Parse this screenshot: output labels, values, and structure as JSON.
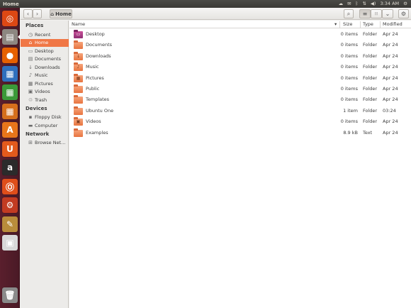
{
  "window": {
    "title": "Home"
  },
  "tray": {
    "indicators": [
      "cloud-icon",
      "mail-icon",
      "bluetooth-icon",
      "network-icon",
      "volume-icon",
      "gear-icon"
    ],
    "clock": "3:34 AM"
  },
  "launcher": {
    "items": [
      {
        "name": "ubuntu-dash-icon",
        "glyph": "◎",
        "color": "#dd4814"
      },
      {
        "name": "files-icon",
        "glyph": "▤",
        "color": "#8d8781"
      },
      {
        "name": "firefox-icon",
        "glyph": "●",
        "color": "#e66000"
      },
      {
        "name": "writer-icon",
        "glyph": "▦",
        "color": "#2f6fbd"
      },
      {
        "name": "calc-icon",
        "glyph": "▦",
        "color": "#3b9a38"
      },
      {
        "name": "impress-icon",
        "glyph": "▦",
        "color": "#d56f1c"
      },
      {
        "name": "software-center-icon",
        "glyph": "A",
        "color": "#e8751a"
      },
      {
        "name": "ubuntu-one-icon",
        "glyph": "U",
        "color": "#e35a1c"
      },
      {
        "name": "amazon-icon",
        "glyph": "a",
        "color": "#2b2b2b"
      },
      {
        "name": "ubuntu-one-music-icon",
        "glyph": "Ⓞ",
        "color": "#df4e1a"
      },
      {
        "name": "system-settings-icon",
        "glyph": "⚙",
        "color": "#c23b22"
      },
      {
        "name": "workspace-switcher-icon",
        "glyph": "✎",
        "color": "#b98c3b"
      },
      {
        "name": "floppy-icon",
        "glyph": "▣",
        "color": "#d8d8d8"
      },
      {
        "name": "trash-icon",
        "glyph": "🗑",
        "color": "#8a8a8a"
      }
    ]
  },
  "toolbar": {
    "back": "‹",
    "forward": "›",
    "breadcrumb_icon": "⌂",
    "breadcrumb": "Home",
    "search": "⌕",
    "list_view": "≡",
    "grid_view": "⦙⦙⦙",
    "dropdown": "⌄",
    "settings": "⚙"
  },
  "sidebar": {
    "sections": [
      {
        "heading": "Places",
        "items": [
          {
            "label": "Recent",
            "icon": "◷",
            "selected": false
          },
          {
            "label": "Home",
            "icon": "⌂",
            "selected": true
          },
          {
            "label": "Desktop",
            "icon": "▭",
            "selected": false
          },
          {
            "label": "Documents",
            "icon": "▤",
            "selected": false
          },
          {
            "label": "Downloads",
            "icon": "↓",
            "selected": false
          },
          {
            "label": "Music",
            "icon": "♪",
            "selected": false
          },
          {
            "label": "Pictures",
            "icon": "▦",
            "selected": false
          },
          {
            "label": "Videos",
            "icon": "▣",
            "selected": false
          },
          {
            "label": "Trash",
            "icon": "♲",
            "selected": false
          }
        ]
      },
      {
        "heading": "Devices",
        "items": [
          {
            "label": "Floppy Disk",
            "icon": "▪",
            "selected": false
          },
          {
            "label": "Computer",
            "icon": "▬",
            "selected": false
          }
        ]
      },
      {
        "heading": "Network",
        "items": [
          {
            "label": "Browse Net...",
            "icon": "⊞",
            "selected": false
          }
        ]
      }
    ]
  },
  "columns": {
    "name": "Name",
    "sort": "▾",
    "size": "Size",
    "type": "Type",
    "modified": "Modified"
  },
  "files": [
    {
      "name": "Desktop",
      "size": "0 items",
      "type": "Folder",
      "modified": "Apr 24",
      "icon": "desktop",
      "glyph": "▭"
    },
    {
      "name": "Documents",
      "size": "0 items",
      "type": "Folder",
      "modified": "Apr 24",
      "icon": "folder",
      "glyph": ""
    },
    {
      "name": "Downloads",
      "size": "0 items",
      "type": "Folder",
      "modified": "Apr 24",
      "icon": "folder",
      "glyph": "↓"
    },
    {
      "name": "Music",
      "size": "0 items",
      "type": "Folder",
      "modified": "Apr 24",
      "icon": "folder",
      "glyph": "♪"
    },
    {
      "name": "Pictures",
      "size": "0 items",
      "type": "Folder",
      "modified": "Apr 24",
      "icon": "folder",
      "glyph": "▦"
    },
    {
      "name": "Public",
      "size": "0 items",
      "type": "Folder",
      "modified": "Apr 24",
      "icon": "folder",
      "glyph": ""
    },
    {
      "name": "Templates",
      "size": "0 items",
      "type": "Folder",
      "modified": "Apr 24",
      "icon": "folder",
      "glyph": ""
    },
    {
      "name": "Ubuntu One",
      "size": "1 item",
      "type": "Folder",
      "modified": "03:24",
      "icon": "folder",
      "glyph": ""
    },
    {
      "name": "Videos",
      "size": "0 items",
      "type": "Folder",
      "modified": "Apr 24",
      "icon": "folder",
      "glyph": "▣"
    },
    {
      "name": "Examples",
      "size": "8.9 kB",
      "type": "Text",
      "modified": "Apr 24",
      "icon": "folder",
      "glyph": ""
    }
  ]
}
